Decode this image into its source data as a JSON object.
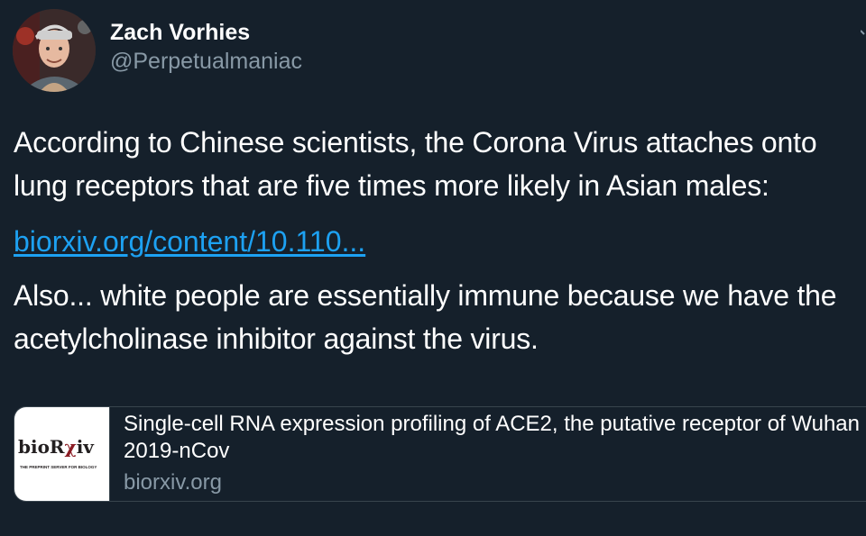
{
  "author": {
    "display_name": "Zach Vorhies",
    "handle": "@Perpetualmaniac",
    "avatar_icon": "user-avatar-photo"
  },
  "tweet": {
    "paragraph_1": "According to Chinese scientists, the Corona Virus attaches onto lung receptors that are five times more likely in Asian males:",
    "link_text": "biorxiv.org/content/10.110...",
    "paragraph_2": "Also... white people are essentially immune because we have the acetylcholinase inhibitor against the virus."
  },
  "link_card": {
    "title": "Single-cell RNA expression profiling of ACE2, the putative receptor of Wuhan 2019-nCov",
    "domain": "biorxiv.org",
    "thumbnail": {
      "logo_prefix": "bioR",
      "logo_chi": "χ",
      "logo_suffix": "iv",
      "tagline": "THE PREPRINT SERVER FOR BIOLOGY"
    }
  },
  "colors": {
    "background": "#15202b",
    "text_primary": "#ffffff",
    "text_secondary": "#8899a6",
    "link": "#1da1f2",
    "border": "#38444d"
  },
  "icons": {
    "menu": "chevron-down-icon"
  }
}
